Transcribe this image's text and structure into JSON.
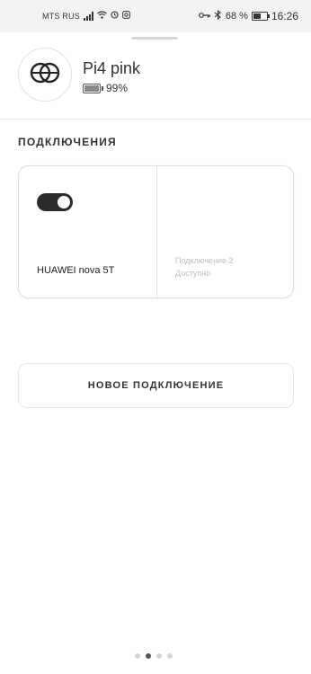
{
  "status_bar": {
    "carrier": "MTS RUS",
    "battery_percent": "68 %",
    "battery_level": 0.68,
    "time": "16:26",
    "icons": [
      "signal-icon",
      "wifi-icon",
      "sync-icon",
      "instagram-icon",
      "key-icon",
      "bluetooth-icon",
      "battery-icon"
    ]
  },
  "device": {
    "name": "Pi4 pink",
    "battery": "99%",
    "battery_level": 0.99,
    "avatar_icon": "interlocking-rings-logo"
  },
  "connections": {
    "section_title": "ПОДКЛЮЧЕНИЯ",
    "slots": [
      {
        "label": "HUAWEI nova 5T",
        "toggle_on": true
      },
      {
        "title": "Подключение 2",
        "status": "Доступно"
      }
    ]
  },
  "new_connection_label": "НОВОЕ ПОДКЛЮЧЕНИЕ",
  "pager": {
    "count": 4,
    "active_index": 1
  },
  "colors": {
    "toggle_on": "#2b2b2b",
    "muted_text": "#bdbdbd",
    "status_bar_bg": "#f2f2f2"
  }
}
